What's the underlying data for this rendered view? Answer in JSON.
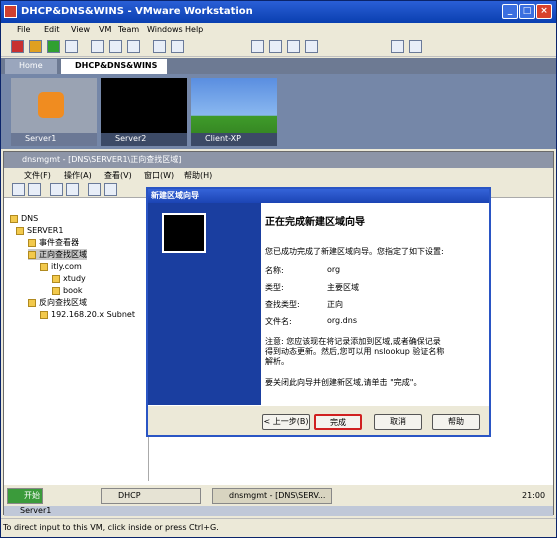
{
  "window": {
    "title": "DHCP&DNS&WINS - VMware Workstation"
  },
  "menu": [
    "File",
    "Edit",
    "View",
    "VM",
    "Team",
    "Windows",
    "Help"
  ],
  "tabs": {
    "home": "Home",
    "active": "DHCP&DNS&WINS"
  },
  "thumbs": [
    "Server1",
    "Server2",
    "Client-XP"
  ],
  "mmc": {
    "title": "dnsmgmt - [DNS\\SERVER1\\正向查找区域]",
    "menu": [
      "文件(F)",
      "操作(A)",
      "查看(V)",
      "窗口(W)",
      "帮助(H)"
    ]
  },
  "tree": [
    {
      "label": "DNS",
      "depth": 0
    },
    {
      "label": "SERVER1",
      "depth": 1
    },
    {
      "label": "事件查看器",
      "depth": 2
    },
    {
      "label": "正向查找区域",
      "depth": 2,
      "selected": true
    },
    {
      "label": "itly.com",
      "depth": 3
    },
    {
      "label": "xtudy",
      "depth": 4
    },
    {
      "label": "book",
      "depth": 4
    },
    {
      "label": "反向查找区域",
      "depth": 2
    },
    {
      "label": "192.168.20.x Subnet",
      "depth": 3
    }
  ],
  "taskbar": {
    "start": "开始",
    "item1": "DHCP",
    "item2": "dnsmgmt - [DNS\\SERV...",
    "time": "21:00",
    "server_tab": "Server1"
  },
  "status": {
    "text": "To direct input to this VM, click inside or press Ctrl+G."
  },
  "dialog": {
    "title": "新建区域向导",
    "heading": "正在完成新建区域向导",
    "intro": "您已成功完成了新建区域向导。您指定了如下设置:",
    "fields": [
      {
        "label": "名称:",
        "value": "org"
      },
      {
        "label": "类型:",
        "value": "主要区域"
      },
      {
        "label": "查找类型:",
        "value": "正向"
      },
      {
        "label": "文件名:",
        "value": "org.dns"
      }
    ],
    "note1": "注意: 您应该现在将记录添加到区域,或者确保记录",
    "note2": "得到动态更新。然后,您可以用 nslookup 验证名称",
    "note3": "解析。",
    "closing": "要关闭此向导并创建新区域,请单击 \"完成\"。",
    "back": "< 上一步(B)",
    "finish": "完成",
    "cancel": "取消",
    "help": "帮助"
  }
}
